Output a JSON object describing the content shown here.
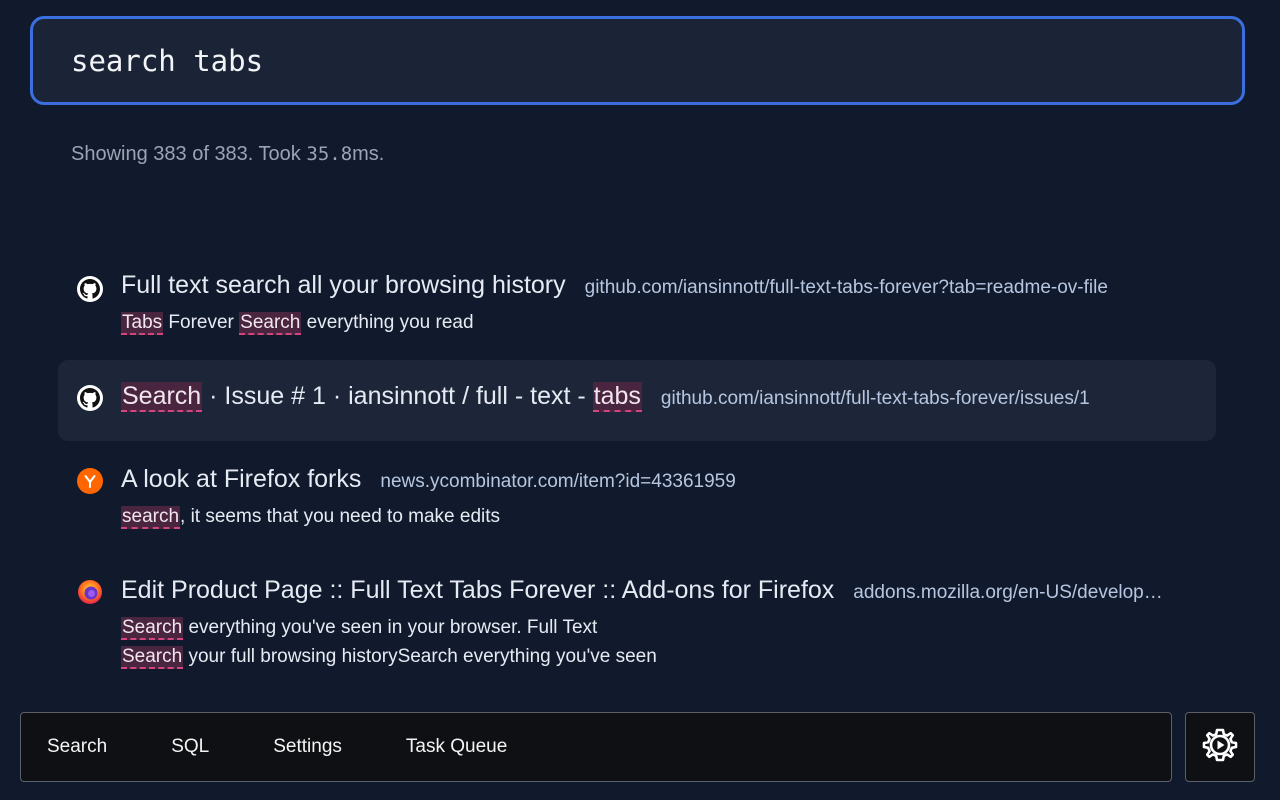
{
  "search": {
    "query": "search tabs"
  },
  "stats": {
    "prefix": "Showing 383 of 383. Took ",
    "time": "35.8",
    "suffix": "ms."
  },
  "results": [
    {
      "icon": "github-icon",
      "title": "Full text search all your browsing history",
      "url": "github.com/iansinnott/full-text-tabs-forever?tab=readme-ov-file",
      "snippet_lines": [
        [
          {
            "text": "Tabs",
            "hl": true
          },
          {
            "text": " Forever ",
            "hl": false
          },
          {
            "text": "Search",
            "hl": true
          },
          {
            "text": " everything you read",
            "hl": false
          }
        ]
      ]
    },
    {
      "icon": "github-icon",
      "title_parts": [
        {
          "text": "Search",
          "hl": true
        },
        {
          "text": " · Issue # 1 · iansinnott / full - text - ",
          "hl": false
        },
        {
          "text": "tabs",
          "hl": true
        }
      ],
      "url": "github.com/iansinnott/full-text-tabs-forever/issues/1"
    },
    {
      "icon": "hacker-news-icon",
      "title": "A look at Firefox forks",
      "url": "news.ycombinator.com/item?id=43361959",
      "snippet_lines": [
        [
          {
            "text": "search",
            "hl": true
          },
          {
            "text": ", it seems that you need to make edits",
            "hl": false
          }
        ]
      ]
    },
    {
      "icon": "firefox-icon",
      "title": "Edit Product Page :: Full Text Tabs Forever :: Add-ons for Firefox",
      "url": "addons.mozilla.org/en-US/develop…",
      "snippet_lines": [
        [
          {
            "text": "Search",
            "hl": true
          },
          {
            "text": " everything you've seen in your browser. Full Text",
            "hl": false
          }
        ],
        [
          {
            "text": "Search",
            "hl": true
          },
          {
            "text": " your full browsing historySearch everything you've seen",
            "hl": false
          }
        ]
      ]
    }
  ],
  "nav": {
    "items": [
      "Search",
      "SQL",
      "Settings",
      "Task Queue"
    ],
    "gear_icon": "gear-play-icon"
  },
  "colors": {
    "background": "#111a2c",
    "accent": "#3b6fe0",
    "highlight": "#d2457e",
    "hn_orange": "#ff6600"
  }
}
